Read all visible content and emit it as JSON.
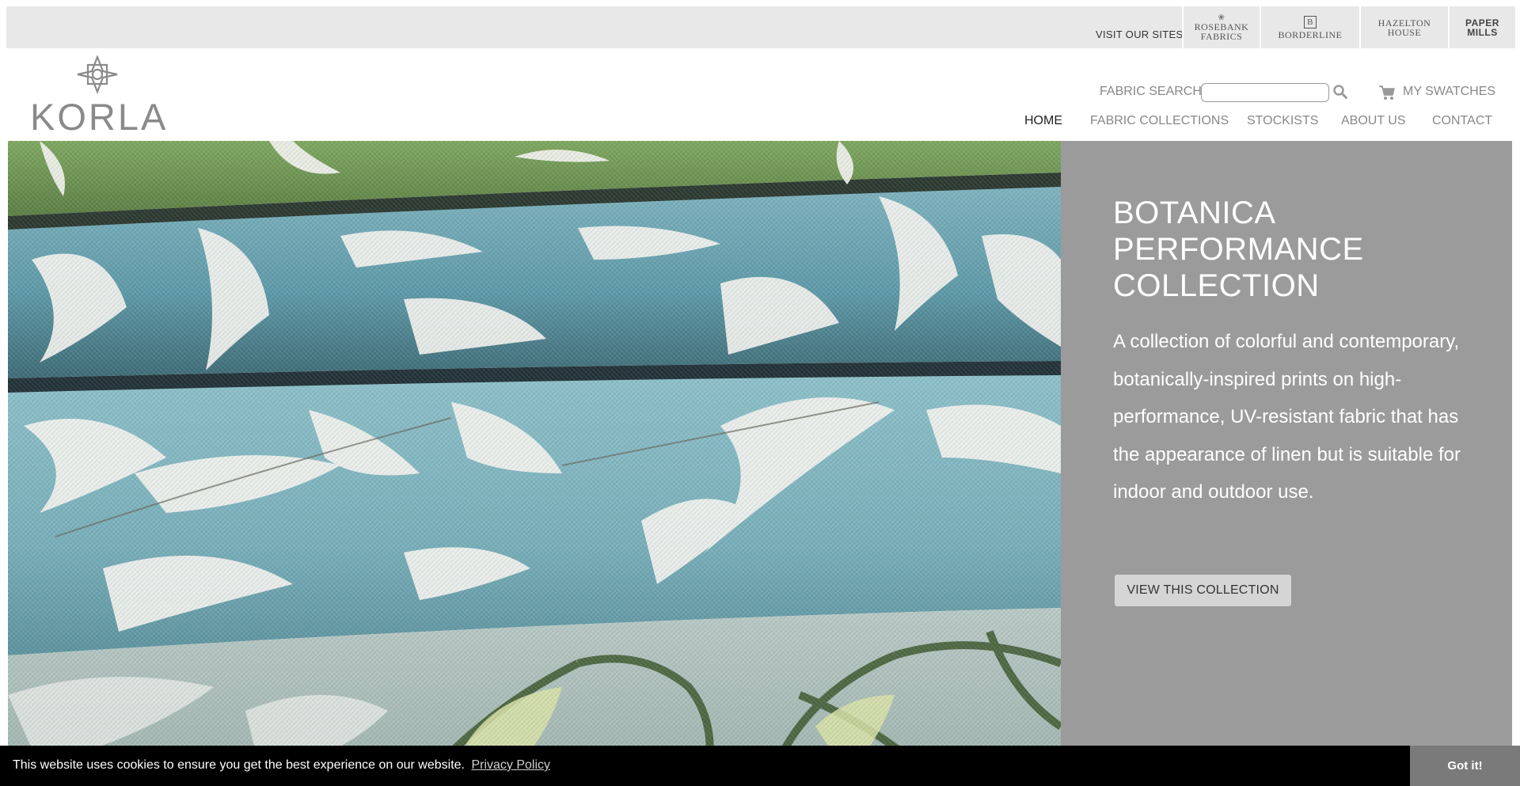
{
  "topbar": {
    "visit_label": "VISIT OUR SITES:",
    "sites": [
      {
        "line1": "ROSEBANK",
        "line2": "FABRICS"
      },
      {
        "line1": "BORDERLINE",
        "line2": ""
      },
      {
        "line1": "HAZELTON",
        "line2": "HOUSE"
      },
      {
        "line1": "PAPER",
        "line2": "MILLS"
      }
    ]
  },
  "brand": {
    "logo_text": "KORLA"
  },
  "search": {
    "label": "FABRIC SEARCH",
    "value": "",
    "placeholder": ""
  },
  "swatches": {
    "label": "MY SWATCHES"
  },
  "nav": {
    "items": [
      {
        "label": "HOME"
      },
      {
        "label": "FABRIC COLLECTIONS"
      },
      {
        "label": "STOCKISTS"
      },
      {
        "label": "ABOUT US"
      },
      {
        "label": "CONTACT"
      }
    ],
    "active": "HOME"
  },
  "hero": {
    "title_line1": "BOTANICA",
    "title_line2": "PERFORMANCE",
    "title_line3": "COLLECTION",
    "description": "A collection of colorful and contemporary, botanically-inspired prints on high-performance, UV-resistant fabric that has the appearance of linen but is suitable for indoor and outdoor use.",
    "button_label": "VIEW THIS COLLECTION"
  },
  "cookie": {
    "message": "This website uses cookies to ensure you get the best experience on our website.",
    "link_label": "Privacy Policy",
    "button_label": "Got it!"
  },
  "colors": {
    "panel_bg": "#9b9b9b",
    "topbar_bg": "#e8e8e8",
    "fabric_teal": "#6fa8b4",
    "fabric_green": "#7a9a5a",
    "cookie_bg": "#000000"
  }
}
